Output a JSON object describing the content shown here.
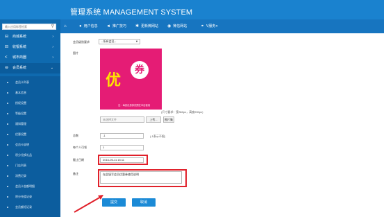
{
  "header": {
    "title": "管理系统 MANAGEMENT SYSTEM",
    "nav": [
      {
        "label": "用户信息",
        "icon": "user-icon"
      },
      {
        "label": "推广技巧",
        "icon": "send-icon"
      },
      {
        "label": "更新微网站",
        "icon": "gear-icon"
      },
      {
        "label": "微信网站",
        "icon": "eye-icon"
      },
      {
        "label": "V服务",
        "icon": "double-chevron-icon"
      }
    ]
  },
  "sidebar": {
    "search_placeholder": "输入应用标签检索",
    "items": [
      {
        "label": "商城系统",
        "icon": "cart-icon"
      },
      {
        "label": "收银系统",
        "icon": "cashier-icon"
      },
      {
        "label": "城市商圈",
        "icon": "share-icon"
      },
      {
        "label": "会员系统",
        "icon": "member-icon"
      }
    ],
    "submenu": [
      "会员卡列表",
      "基本信息",
      "授权设置",
      "等级设置",
      "通知管理",
      "优惠设置",
      "会员卡说明",
      "积分兑换礼品",
      "门店列表",
      "消费记录",
      "会员卡金额明细",
      "积分充值记录",
      "会员额短记录"
    ]
  },
  "form": {
    "level_label": "会员级别要求",
    "level_value": "--所有会员--",
    "image_label": "图片",
    "poster": {
      "big": "优",
      "circle": "券",
      "small": "注：每张优惠券仅限在本店使用"
    },
    "image_hint": "(尺寸要求：宽360px，高度200px)",
    "file_placeholder": "未选择文件",
    "upload_button": "上传...",
    "preview_button": "图片集",
    "count_label": "总数",
    "count_value": "-1",
    "count_note": "(-1表示不限)",
    "per_user_label": "每个人可领",
    "per_user_value": "1",
    "deadline_label": "截止日期",
    "deadline_value": "2016-05-11 15:11",
    "remark_label": "备注",
    "remark_value": "在此填写会员优惠券使用说明",
    "submit_button": "提交",
    "cancel_button": "取消"
  },
  "colors": {
    "header": "#1a82cf",
    "sidebar": "#0f6aaf",
    "button": "#1b8ad6",
    "highlight": "#e0202a",
    "poster": "#e51c75"
  }
}
